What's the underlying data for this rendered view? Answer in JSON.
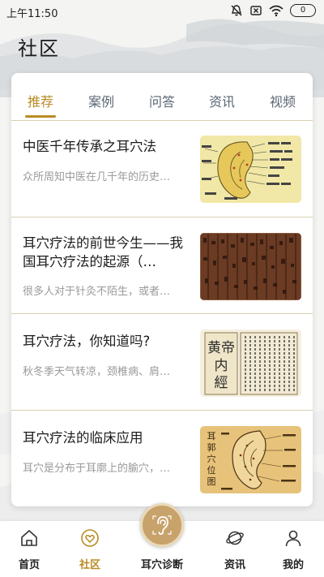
{
  "status_bar": {
    "time": "上午11:50",
    "battery": "0",
    "icons": [
      "do-not-disturb-icon",
      "sim-off-icon",
      "wifi-icon",
      "battery-icon"
    ]
  },
  "header": {
    "title": "社区"
  },
  "tabs": [
    {
      "label": "推荐",
      "active": true
    },
    {
      "label": "案例",
      "active": false
    },
    {
      "label": "问答",
      "active": false
    },
    {
      "label": "资讯",
      "active": false
    },
    {
      "label": "视频",
      "active": false
    }
  ],
  "articles": [
    {
      "title": "中医千年传承之耳穴法",
      "summary": "众所周知中医在几千年的历史…",
      "thumbnail": "ear-acupoint-chart"
    },
    {
      "title": "耳穴疗法的前世今生——我国耳穴疗法的起源（…",
      "summary": "很多人对于针灸不陌生，或者…",
      "thumbnail": "ancient-bamboo-manuscript"
    },
    {
      "title": "耳穴疗法，你知道吗?",
      "summary": "秋冬季天气转凉，颈椎病、肩…",
      "thumbnail": "huangdi-neijing-book",
      "thumbnail_text": "黄帝内經"
    },
    {
      "title": "耳穴疗法的临床应用",
      "summary": "耳穴是分布于耳廓上的腧穴，…",
      "thumbnail": "ear-point-illustration",
      "thumbnail_text": "耳郭穴位图"
    }
  ],
  "bottom_nav": [
    {
      "label": "首页",
      "icon": "home-icon",
      "active": false
    },
    {
      "label": "社区",
      "icon": "community-heart-icon",
      "active": true
    },
    {
      "label": "耳穴诊断",
      "icon": "ear-diagnosis-icon",
      "active": false
    },
    {
      "label": "资讯",
      "icon": "planet-news-icon",
      "active": false
    },
    {
      "label": "我的",
      "icon": "profile-icon",
      "active": false
    }
  ],
  "colors": {
    "accent": "#b98b25",
    "divider": "#d8cfae",
    "summary": "#9a9a9a",
    "tab_inactive": "#5a6673",
    "center_button": "#c8a26b"
  }
}
